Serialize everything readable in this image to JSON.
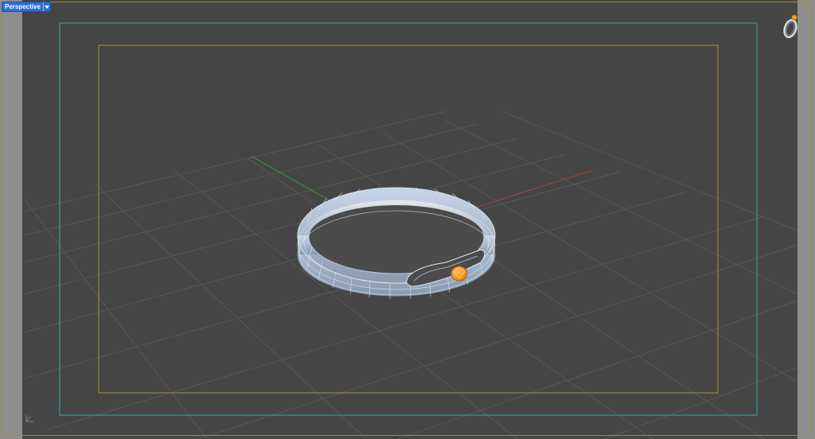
{
  "viewport": {
    "name": "Perspective",
    "colors": {
      "background": "#464646",
      "grid": "#5a5a5a",
      "grid_major": "#6b6b6b",
      "x_axis": "#b04040",
      "y_axis": "#3a9a3a",
      "safe_frame_outer": "#3aa6a6",
      "safe_frame_inner": "#b0923a",
      "ring_body": "#b8c6d8",
      "ring_wire": "#e6eef8",
      "gem": "#f08a14"
    }
  },
  "icons": {
    "dropdown": "chevron-down-icon",
    "ring_preview": "ring-thumbnail-icon",
    "axis_widget": "axis-gizmo-icon"
  }
}
